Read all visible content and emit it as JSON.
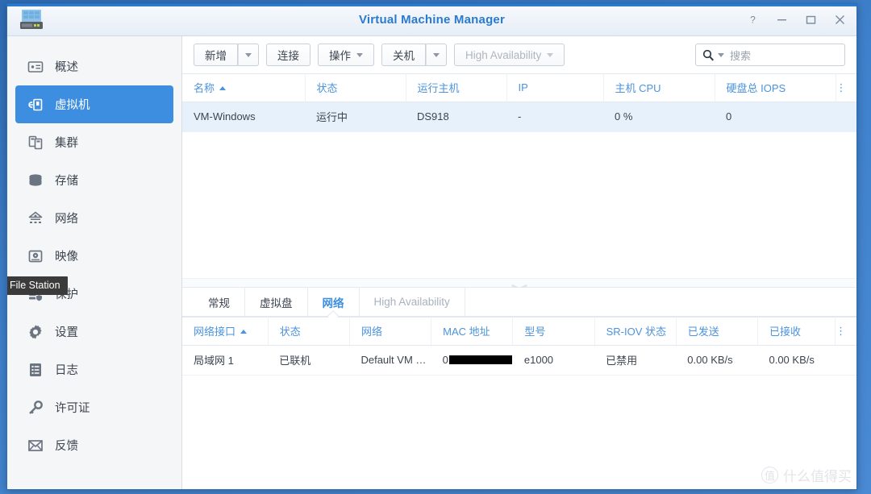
{
  "window": {
    "title": "Virtual Machine Manager",
    "logo_icon": "synology-nas-icon",
    "controls": [
      {
        "name": "help-button",
        "icon": "question-mark-icon",
        "glyph": "?"
      },
      {
        "name": "minimize-button",
        "icon": "minimize-icon",
        "glyph": "–"
      },
      {
        "name": "maximize-button",
        "icon": "maximize-icon",
        "glyph": "□"
      },
      {
        "name": "close-button",
        "icon": "close-icon",
        "glyph": "×"
      }
    ]
  },
  "sidebar": {
    "items": [
      {
        "label": "概述",
        "icon": "overview-icon",
        "active": false
      },
      {
        "label": "虚拟机",
        "icon": "virtual-machine-icon",
        "active": true
      },
      {
        "label": "集群",
        "icon": "cluster-icon",
        "active": false
      },
      {
        "label": "存储",
        "icon": "storage-icon",
        "active": false
      },
      {
        "label": "网络",
        "icon": "network-icon",
        "active": false
      },
      {
        "label": "映像",
        "icon": "image-icon",
        "active": false
      },
      {
        "label": "保护",
        "icon": "protection-icon",
        "active": false
      },
      {
        "label": "设置",
        "icon": "settings-gear-icon",
        "active": false
      },
      {
        "label": "日志",
        "icon": "log-icon",
        "active": false
      },
      {
        "label": "许可证",
        "icon": "license-key-icon",
        "active": false
      },
      {
        "label": "反馈",
        "icon": "feedback-mail-icon",
        "active": false
      }
    ]
  },
  "tooltip": {
    "text": "File Station"
  },
  "toolbar": {
    "create_label": "新增",
    "connect_label": "连接",
    "action_label": "操作",
    "shutdown_label": "关机",
    "high_availability_label": "High Availability"
  },
  "search": {
    "placeholder": "搜索",
    "value": ""
  },
  "vm_table": {
    "columns": [
      {
        "label": "名称",
        "sorted": true
      },
      {
        "label": "状态",
        "sorted": false
      },
      {
        "label": "运行主机",
        "sorted": false
      },
      {
        "label": "IP",
        "sorted": false
      },
      {
        "label": "主机 CPU",
        "sorted": false
      },
      {
        "label": "硬盘总 IOPS",
        "sorted": false
      }
    ],
    "rows": [
      {
        "name": "VM-Windows",
        "status": "运行中",
        "host": "DS918",
        "ip": "-",
        "cpu": "0 %",
        "iops": "0",
        "selected": true
      }
    ],
    "menu_icon": "vertical-dots-icon"
  },
  "detail_tabs": [
    {
      "label": "常规",
      "active": false,
      "disabled": false
    },
    {
      "label": "虚拟盘",
      "active": false,
      "disabled": false
    },
    {
      "label": "网络",
      "active": true,
      "disabled": false
    },
    {
      "label": "High Availability",
      "active": false,
      "disabled": true
    }
  ],
  "nic_table": {
    "columns": [
      {
        "label": "网络接口",
        "sorted": true
      },
      {
        "label": "状态",
        "sorted": false
      },
      {
        "label": "网络",
        "sorted": false
      },
      {
        "label": "MAC 地址",
        "sorted": false
      },
      {
        "label": "型号",
        "sorted": false
      },
      {
        "label": "SR-IOV 状态",
        "sorted": false
      },
      {
        "label": "已发送",
        "sorted": false
      },
      {
        "label": "已接收",
        "sorted": false
      }
    ],
    "rows": [
      {
        "interface": "局域网 1",
        "status": "已联机",
        "network": "Default VM N...",
        "mac_prefix": "0",
        "mac_redacted": true,
        "model": "e1000",
        "sriov": "已禁用",
        "sent": "0.00 KB/s",
        "received": "0.00 KB/s"
      }
    ],
    "menu_icon": "vertical-dots-icon"
  },
  "watermark": {
    "mark": "值",
    "text": "什么值得买"
  },
  "colors": {
    "accent": "#3d8ee0",
    "header_link": "#4b93dd",
    "status_ok": "#5aa832",
    "selected_row": "#e7f1fb",
    "desktop": "#3d7bc4"
  }
}
